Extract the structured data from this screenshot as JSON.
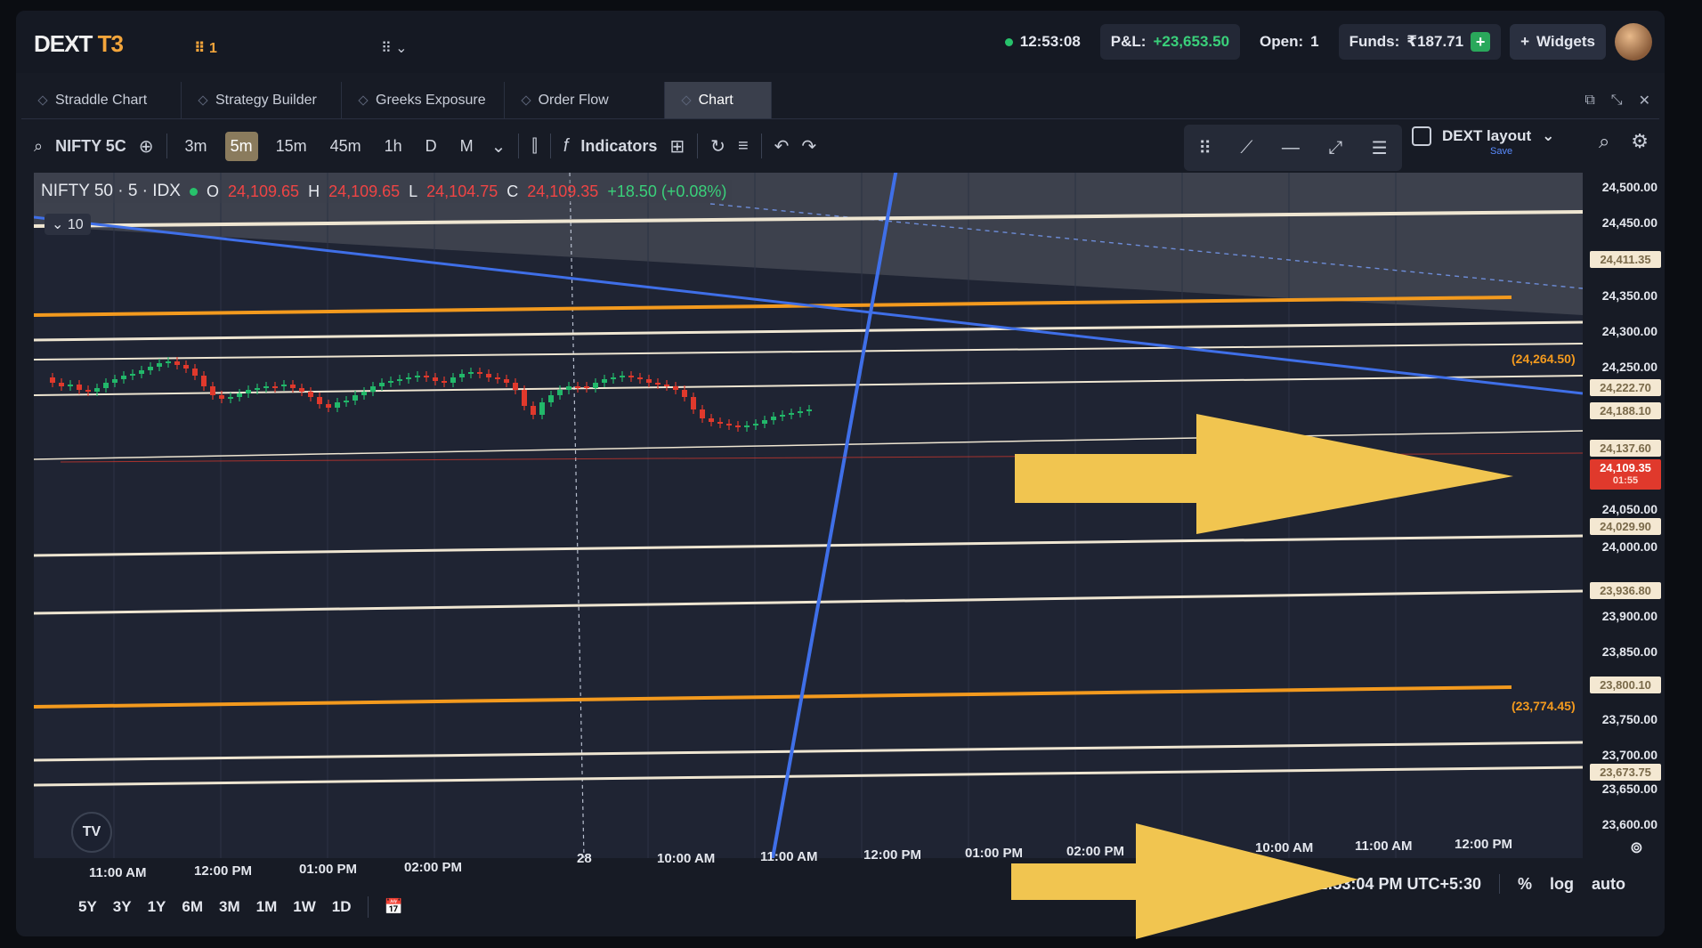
{
  "topbar": {
    "logo_main": "DEXT",
    "logo_suffix": "T3",
    "workspace_badge": "⠿ 1",
    "layout_menu": "⠿ ⌄",
    "time": "12:53:08",
    "pnl_label": "P&L:",
    "pnl_value": "+23,653.50",
    "open_label": "Open:",
    "open_value": "1",
    "funds_label": "Funds:",
    "funds_value": "₹187.71",
    "widgets_label": "Widgets"
  },
  "tabs": [
    {
      "label": "Straddle Chart"
    },
    {
      "label": "Strategy Builder"
    },
    {
      "label": "Greeks Exposure"
    },
    {
      "label": "Order Flow"
    },
    {
      "label": "Chart",
      "active": true
    }
  ],
  "toolbar": {
    "symbol": "NIFTY 5C",
    "timeframes": [
      "3m",
      "5m",
      "15m",
      "45m",
      "1h",
      "D",
      "M"
    ],
    "active_timeframe": "5m",
    "indicators_label": "Indicators",
    "layout_label": "DEXT layout",
    "layout_sub": "Save"
  },
  "legend": {
    "symbol": "NIFTY 50 · 5 · IDX",
    "o_label": "O",
    "o": "24,109.65",
    "h_label": "H",
    "h": "24,109.65",
    "l_label": "L",
    "l": "24,104.75",
    "c_label": "C",
    "c": "24,109.35",
    "change": "+18.50 (+0.08%)",
    "collapse_count": "10"
  },
  "price_axis": {
    "ticks": [
      "24,500.00",
      "24,450.00",
      "24,350.00",
      "24,300.00",
      "24,250.00",
      "24,050.00",
      "24,000.00",
      "23,900.00",
      "23,850.00",
      "23,750.00",
      "23,700.00",
      "23,650.00",
      "23,600.00"
    ],
    "tags": [
      "24,411.35",
      "24,222.70",
      "24,188.10",
      "24,137.60",
      "24,029.90",
      "23,936.80",
      "23,800.10",
      "23,673.75"
    ],
    "current_price": "24,109.35",
    "current_countdown": "01:55",
    "level_labels": [
      "(24,264.50)",
      "(23,774.45)"
    ]
  },
  "time_axis": {
    "ticks": [
      "11:00 AM",
      "12:00 PM",
      "01:00 PM",
      "02:00 PM",
      "28",
      "10:00 AM",
      "11:00 AM",
      "12:00 PM",
      "01:00 PM",
      "02:00 PM",
      "10:00 AM",
      "11:00 AM",
      "12:00 PM"
    ]
  },
  "bottombar": {
    "ranges": [
      "5Y",
      "3Y",
      "1Y",
      "6M",
      "3M",
      "1M",
      "1W",
      "1D"
    ],
    "clock": "12:53:04 PM UTC+5:30",
    "percent": "%",
    "log": "log",
    "auto": "auto"
  },
  "colors": {
    "accent_orange": "#f3a53b",
    "level_orange": "#f39a1e",
    "level_white": "#efe6d2",
    "trend_blue": "#3f6fe8",
    "bull": "#22b86a",
    "bear": "#e0392c",
    "arrow_yellow": "#f1c550"
  }
}
